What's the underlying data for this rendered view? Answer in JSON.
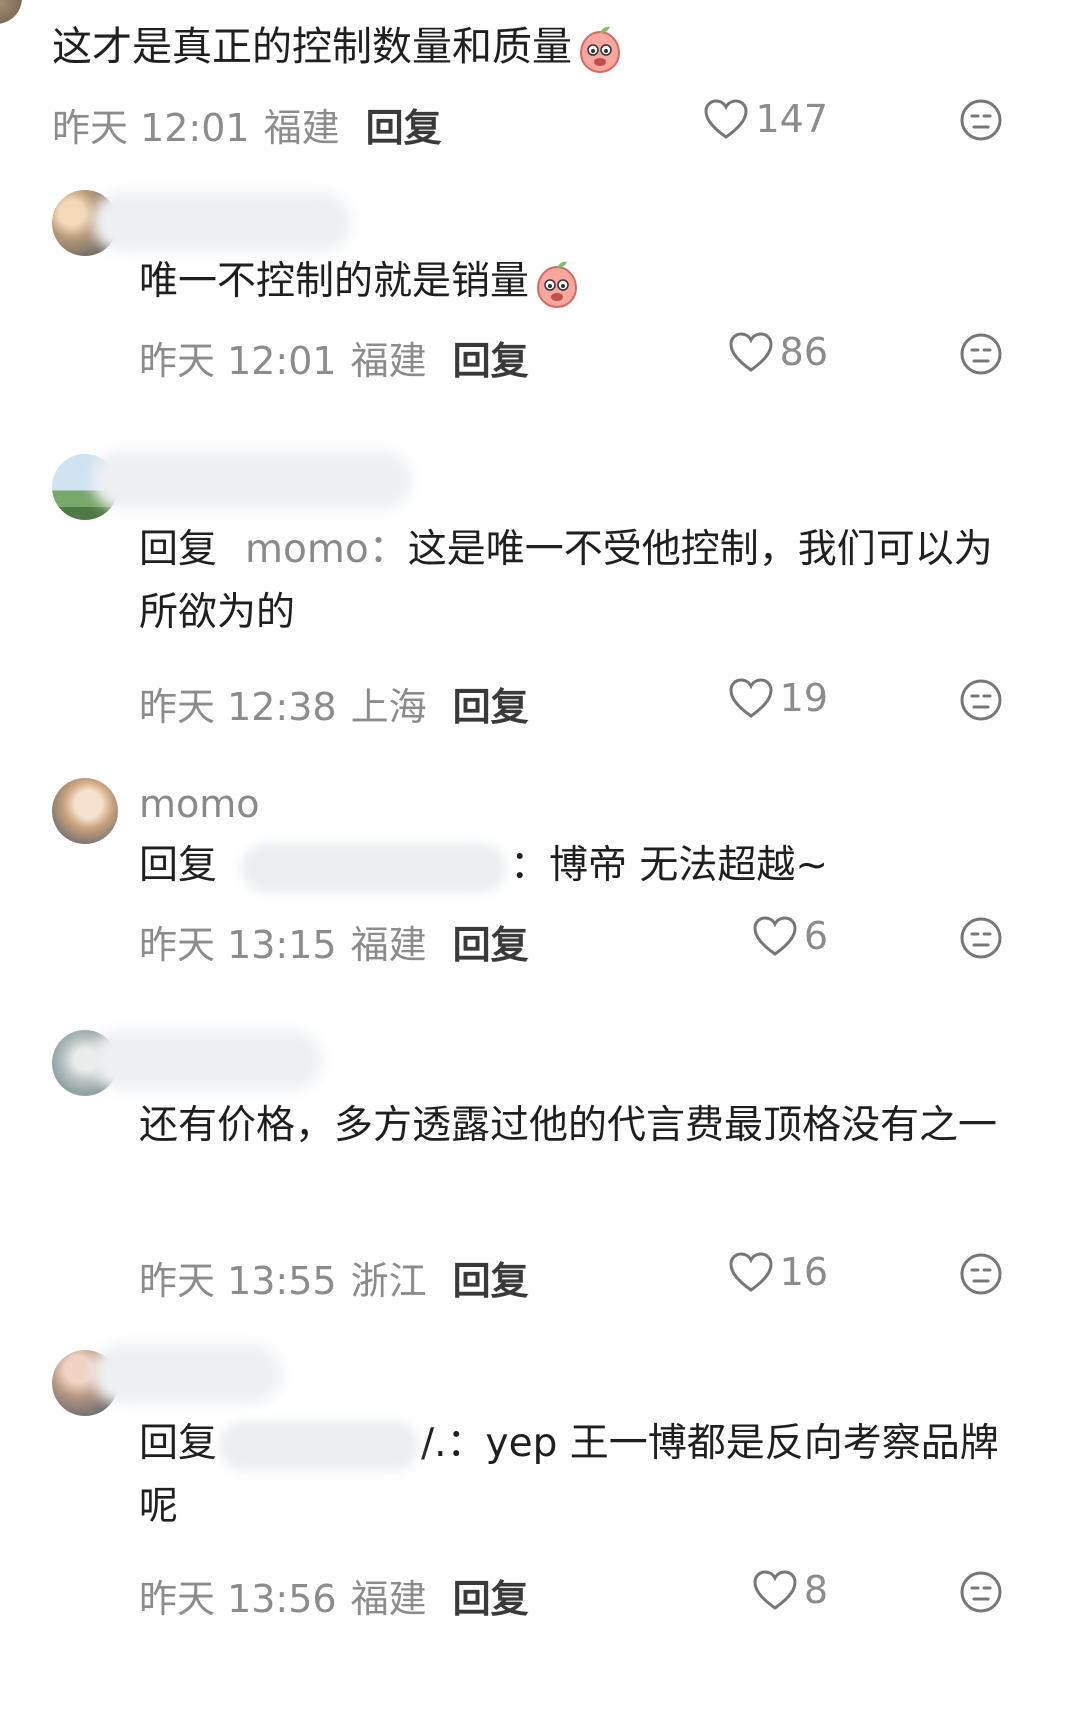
{
  "comments": [
    {
      "text": "这才是真正的控制数量和质量",
      "meta": {
        "date": "昨天 12:01",
        "location": "福建",
        "reply": "回复"
      },
      "likes": "147"
    },
    {
      "text": "唯一不控制的就是销量",
      "meta": {
        "date": "昨天 12:01",
        "location": "福建",
        "reply": "回复"
      },
      "likes": "86"
    },
    {
      "reply_prefix": "回复",
      "mention": "momo：",
      "text": "这是唯一不受他控制，我们可以为所欲为的",
      "meta": {
        "date": "昨天 12:38",
        "location": "上海",
        "reply": "回复"
      },
      "likes": "19"
    },
    {
      "username": "momo",
      "reply_prefix": "回复",
      "text": "：博帝 无法超越~",
      "meta": {
        "date": "昨天 13:15",
        "location": "福建",
        "reply": "回复"
      },
      "likes": "6"
    },
    {
      "text": "还有价格，多方透露过他的代言费最顶格没有之一",
      "meta": {
        "date": "昨天 13:55",
        "location": "浙江",
        "reply": "回复"
      },
      "likes": "16"
    },
    {
      "reply_prefix": "回复",
      "text": "/.：yep 王一博都是反向考察品牌呢",
      "meta": {
        "date": "昨天 13:56",
        "location": "福建",
        "reply": "回复"
      },
      "likes": "8"
    }
  ]
}
